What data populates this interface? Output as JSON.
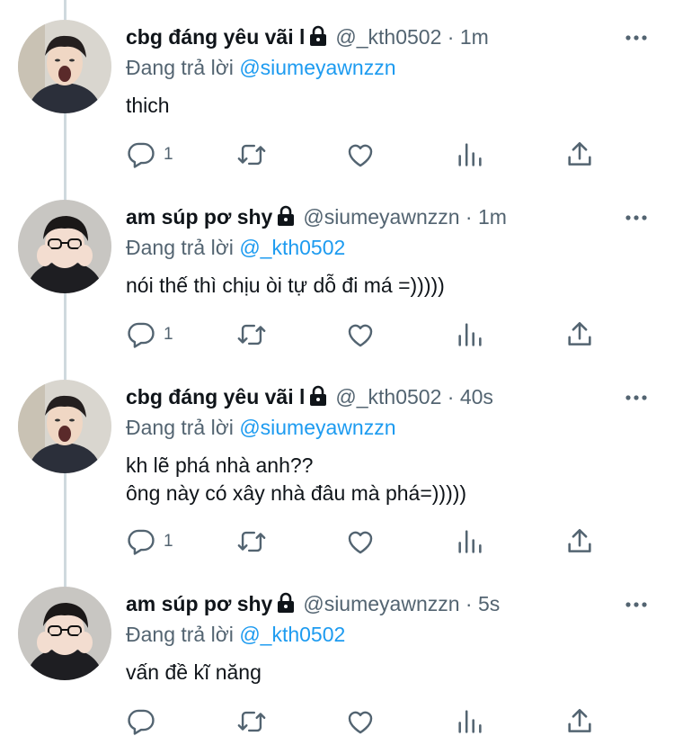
{
  "colors": {
    "text": "#0f1419",
    "secondary": "#536471",
    "accent": "#1d9bf0",
    "thread_line": "#cfd9de"
  },
  "tweets": [
    {
      "name": "cbg đáng yêu vãi l",
      "handle": "@_kth0502",
      "dot": "·",
      "time": "1m",
      "reply_prefix": "Đang trả lời ",
      "reply_to": "@siumeyawnzzn",
      "lines": [
        "thich"
      ],
      "reply_count": "1",
      "avatar": "avatar-shouting",
      "icons": [
        "lock-icon",
        "more-icon",
        "reply-icon",
        "retweet-icon",
        "like-icon",
        "analytics-icon",
        "share-icon"
      ]
    },
    {
      "name": "am súp pơ shy",
      "handle": "@siumeyawnzzn",
      "dot": "·",
      "time": "1m",
      "reply_prefix": "Đang trả lời ",
      "reply_to": "@_kth0502",
      "lines": [
        "nói thế thì chịu òi tự dỗ đi má =)))))"
      ],
      "reply_count": "1",
      "avatar": "avatar-glasses"
    },
    {
      "name": "cbg đáng yêu vãi l",
      "handle": "@_kth0502",
      "dot": "·",
      "time": "40s",
      "reply_prefix": "Đang trả lời ",
      "reply_to": "@siumeyawnzzn",
      "lines": [
        "kh lẽ phá nhà anh??",
        "ông này có xây nhà đâu mà phá=)))))"
      ],
      "reply_count": "1",
      "avatar": "avatar-shouting"
    },
    {
      "name": "am súp pơ shy",
      "handle": "@siumeyawnzzn",
      "dot": "·",
      "time": "5s",
      "reply_prefix": "Đang trả lời ",
      "reply_to": "@_kth0502",
      "lines": [
        "vấn đề kĩ năng"
      ],
      "reply_count": "",
      "avatar": "avatar-glasses"
    }
  ]
}
